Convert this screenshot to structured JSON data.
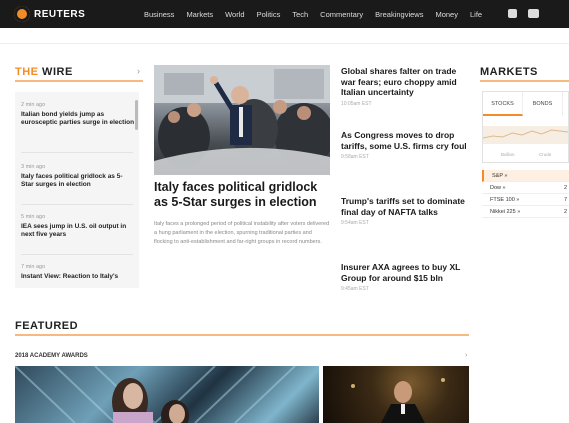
{
  "brand": {
    "name": "REUTERS",
    "accent": "#f28c28"
  },
  "nav": {
    "items": [
      "Business",
      "Markets",
      "World",
      "Politics",
      "Tech",
      "Commentary",
      "Breakingviews",
      "Money",
      "Life"
    ],
    "icons": [
      "camera-icon",
      "video-icon"
    ]
  },
  "wire": {
    "title_prefix": "THE",
    "title_main": " WIRE",
    "items": [
      {
        "time": "2 min ago",
        "headline": "Italian bond yields jump as eurosceptic parties surge in election"
      },
      {
        "time": "3 min ago",
        "headline": "Italy faces political gridlock as 5-Star surges in election"
      },
      {
        "time": "5 min ago",
        "headline": "IEA sees jump in U.S. oil output in next five years"
      },
      {
        "time": "7 min ago",
        "headline": "Instant View: Reaction to Italy's"
      }
    ]
  },
  "lead": {
    "headline": "Italy faces political gridlock as 5-Star surges in election",
    "summary": "Italy faces a prolonged period of political instability after voters delivered a hung parliament in the election, spurning traditional parties and flocking to anti-establishment and far-right groups in record numbers."
  },
  "stories": [
    {
      "headline": "Global shares falter on trade war fears; euro choppy amid Italian uncertainty",
      "time": "10:05am EST"
    },
    {
      "headline": "As Congress moves to drop tariffs, some U.S. firms cry foul",
      "time": "9:58am EST"
    },
    {
      "headline": "Trump's tariffs set to dominate final day of NAFTA talks",
      "time": "9:54am EST"
    },
    {
      "headline": "Insurer AXA agrees to buy XL Group for around $15 bln",
      "time": "9:45am EST"
    }
  ],
  "markets": {
    "title": "MARKETS",
    "tabs": [
      "STOCKS",
      "BONDS"
    ],
    "legend": [
      "Bullion",
      "Crude"
    ],
    "rows": [
      {
        "label": "S&P »",
        "value": ""
      },
      {
        "label": "Dow »",
        "value": "2"
      },
      {
        "label": "FTSE 100 »",
        "value": "7"
      },
      {
        "label": "Nikkei 225 »",
        "value": "2"
      }
    ]
  },
  "featured": {
    "title": "FEATURED",
    "subtitle": "2018 ACADEMY AWARDS"
  }
}
